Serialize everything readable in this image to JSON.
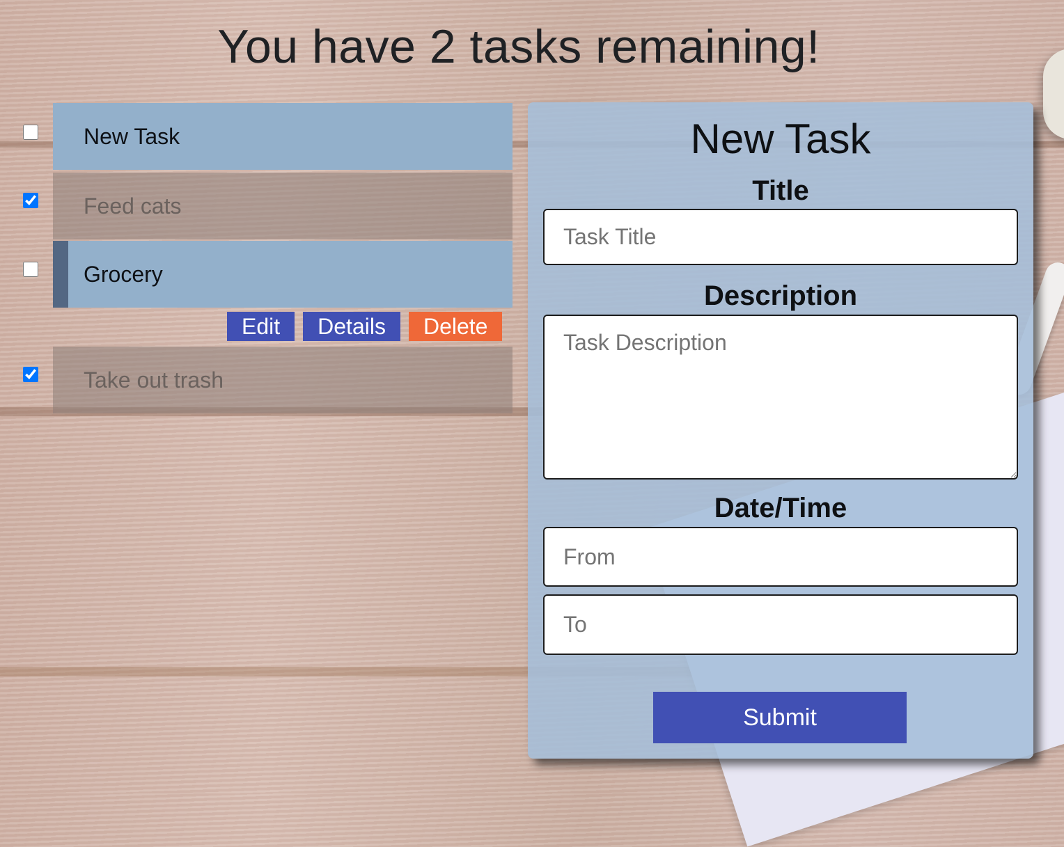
{
  "header": {
    "title": "You have 2 tasks remaining!"
  },
  "tasks": [
    {
      "title": "New Task",
      "completed": false,
      "selected": false
    },
    {
      "title": "Feed cats",
      "completed": true,
      "selected": false
    },
    {
      "title": "Grocery",
      "completed": false,
      "selected": true
    },
    {
      "title": "Take out trash",
      "completed": true,
      "selected": false
    }
  ],
  "task_actions": {
    "edit_label": "Edit",
    "details_label": "Details",
    "delete_label": "Delete"
  },
  "form": {
    "heading": "New Task",
    "title_label": "Title",
    "title_placeholder": "Task Title",
    "description_label": "Description",
    "description_placeholder": "Task Description",
    "datetime_label": "Date/Time",
    "from_placeholder": "From",
    "to_placeholder": "To",
    "submit_label": "Submit"
  },
  "colors": {
    "task_open": "#93b0cb",
    "task_selected_bar": "#536783",
    "button_primary": "#4150b4",
    "button_danger": "#ef6838",
    "panel_bg": "#a5bed9"
  }
}
